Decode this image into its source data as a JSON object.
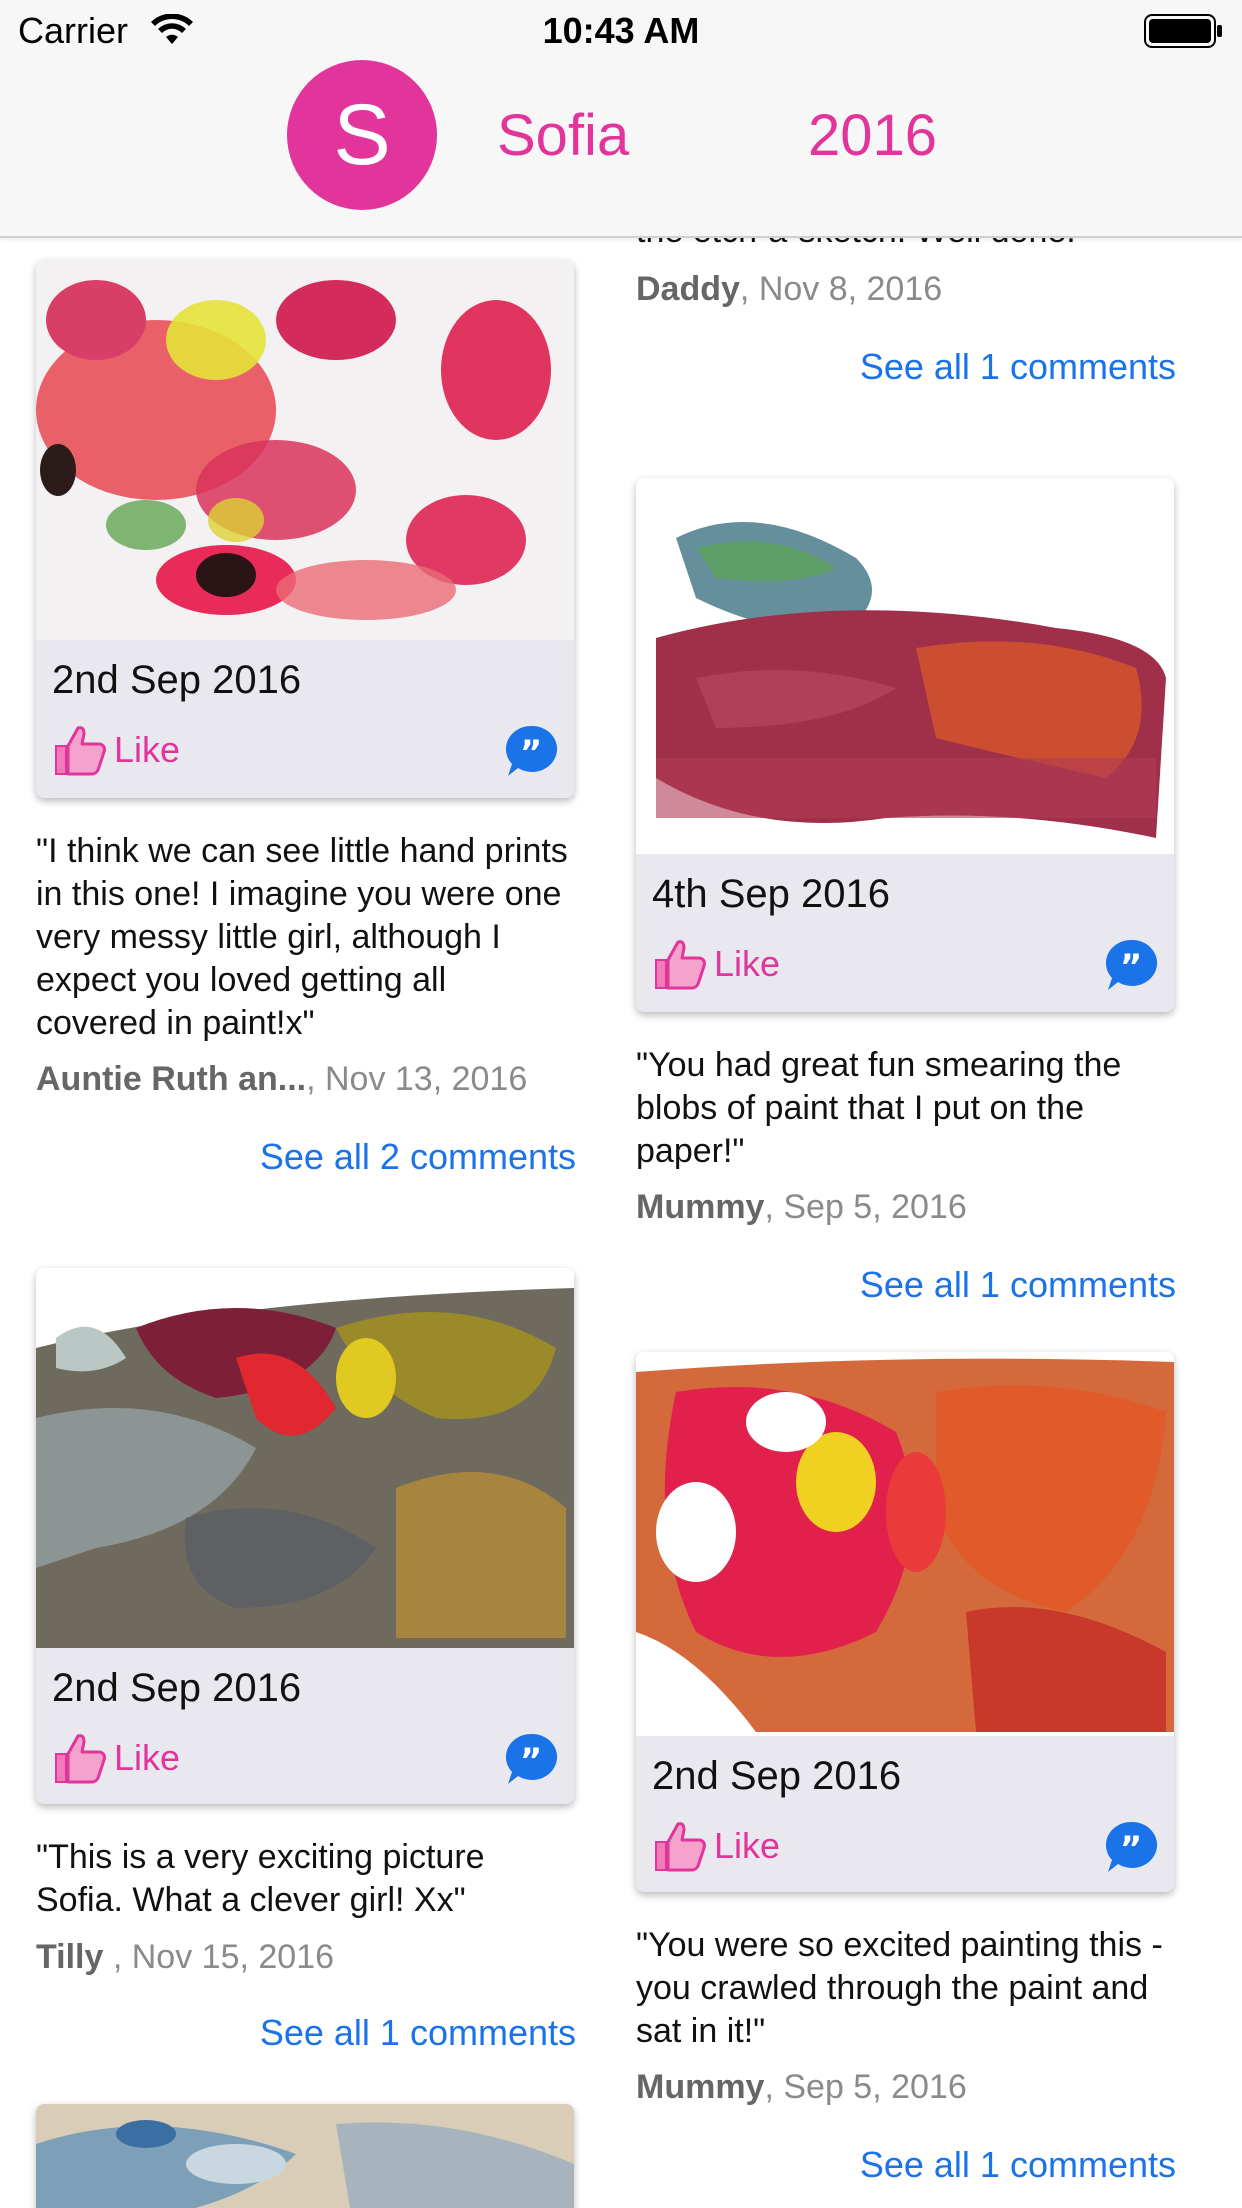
{
  "status_bar": {
    "carrier": "Carrier",
    "time": "10:43 AM"
  },
  "header": {
    "avatar_initial": "S",
    "name": "Sofia",
    "year": "2016",
    "accent_color": "#e2359b"
  },
  "colors": {
    "accent": "#e2359b",
    "link": "#1a73e8",
    "card_bg": "#e9e8ee"
  },
  "top_partial": {
    "quote_tail": "the etch-a-sketch. Well done.",
    "author": "Daddy",
    "date": ", Nov 8, 2016",
    "see_all": "See all 1 comments"
  },
  "posts": [
    {
      "date": "2nd Sep 2016",
      "like_label": "Like",
      "quote": "\"I think we can see little hand prints in this one! I imagine you were one very messy little girl, although I expect you loved getting all covered in  paint!x\"",
      "author": "Auntie Ruth an...",
      "comment_date": ", Nov 13, 2016",
      "see_all": "See all 2 comments"
    },
    {
      "date": "4th Sep 2016",
      "like_label": "Like",
      "quote": "\"You had great fun smearing the blobs of paint that I put on the paper!\"",
      "author": "Mummy",
      "comment_date": ", Sep 5, 2016",
      "see_all": "See all 1 comments"
    },
    {
      "date": "2nd Sep 2016",
      "like_label": "Like",
      "quote": "\"This is a very exciting picture Sofia. What a clever girl! Xx\"",
      "author": "Tilly ",
      "comment_date": ", Nov 15, 2016",
      "see_all": "See all 1 comments"
    },
    {
      "date": "2nd Sep 2016",
      "like_label": "Like",
      "quote": "\"You were so excited painting this - you crawled through the paint and sat in it!\"",
      "author": "Mummy",
      "comment_date": ", Sep 5, 2016",
      "see_all": "See all 1 comments"
    }
  ],
  "icons": {
    "like": "thumbs-up-icon",
    "comment": "quote-bubble-icon",
    "wifi": "wifi-icon",
    "battery": "battery-icon"
  }
}
